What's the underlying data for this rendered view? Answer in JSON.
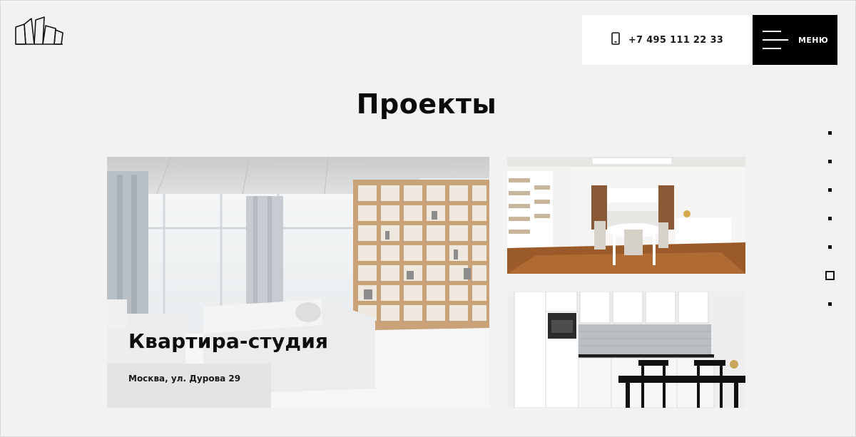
{
  "header": {
    "phone": "+7 495 111 22 33",
    "menu_label": "МЕНЮ"
  },
  "page": {
    "title": "Проекты"
  },
  "projects": [
    {
      "title": "Квартира-студия",
      "address": "Москва, ул. Дурова 29"
    }
  ],
  "pager": {
    "count": 7,
    "active_index": 5
  },
  "colors": {
    "background": "#f2f2f2",
    "menu_bg": "#000000",
    "phone_bg": "#ffffff",
    "text": "#111111"
  },
  "icons": [
    "logo-icon",
    "phone-icon",
    "burger-menu-icon"
  ]
}
